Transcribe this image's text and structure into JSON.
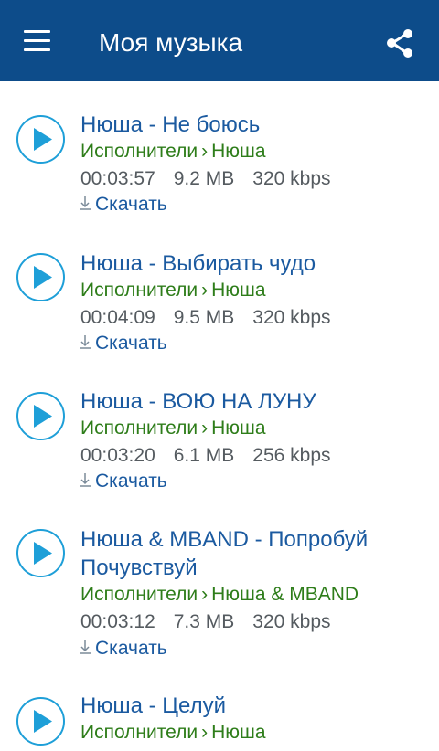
{
  "app_bar": {
    "title": "Моя музыка",
    "menu_icon": "hamburger-menu-icon",
    "share_icon": "share-icon",
    "color": "#0d4c8a"
  },
  "colors": {
    "title_blue": "#1b5aa0",
    "path_green": "#2e7d1a",
    "meta_gray": "#555b60",
    "play_accent": "#1e9fd8"
  },
  "tracks": [
    {
      "title": "Нюша - Не боюсь",
      "path_root": "Исполнители",
      "path_sep": "›",
      "path_leaf": "Нюша",
      "duration": "00:03:57",
      "size": "9.2 MB",
      "bitrate": "320 kbps",
      "download": "Скачать"
    },
    {
      "title": "Нюша - Выбирать чудо",
      "path_root": "Исполнители",
      "path_sep": "›",
      "path_leaf": "Нюша",
      "duration": "00:04:09",
      "size": "9.5 MB",
      "bitrate": "320 kbps",
      "download": "Скачать"
    },
    {
      "title": "Нюша - ВОЮ НА ЛУНУ",
      "path_root": "Исполнители",
      "path_sep": "›",
      "path_leaf": "Нюша",
      "duration": "00:03:20",
      "size": "6.1 MB",
      "bitrate": "256 kbps",
      "download": "Скачать"
    },
    {
      "title": "Нюша & MBAND - Попробуй Почувствуй",
      "path_root": "Исполнители",
      "path_sep": "›",
      "path_leaf": "Нюша & MBAND",
      "duration": "00:03:12",
      "size": "7.3 MB",
      "bitrate": "320 kbps",
      "download": "Скачать"
    },
    {
      "title": "Нюша - Целуй",
      "path_root": "Исполнители",
      "path_sep": "›",
      "path_leaf": "Нюша"
    }
  ]
}
